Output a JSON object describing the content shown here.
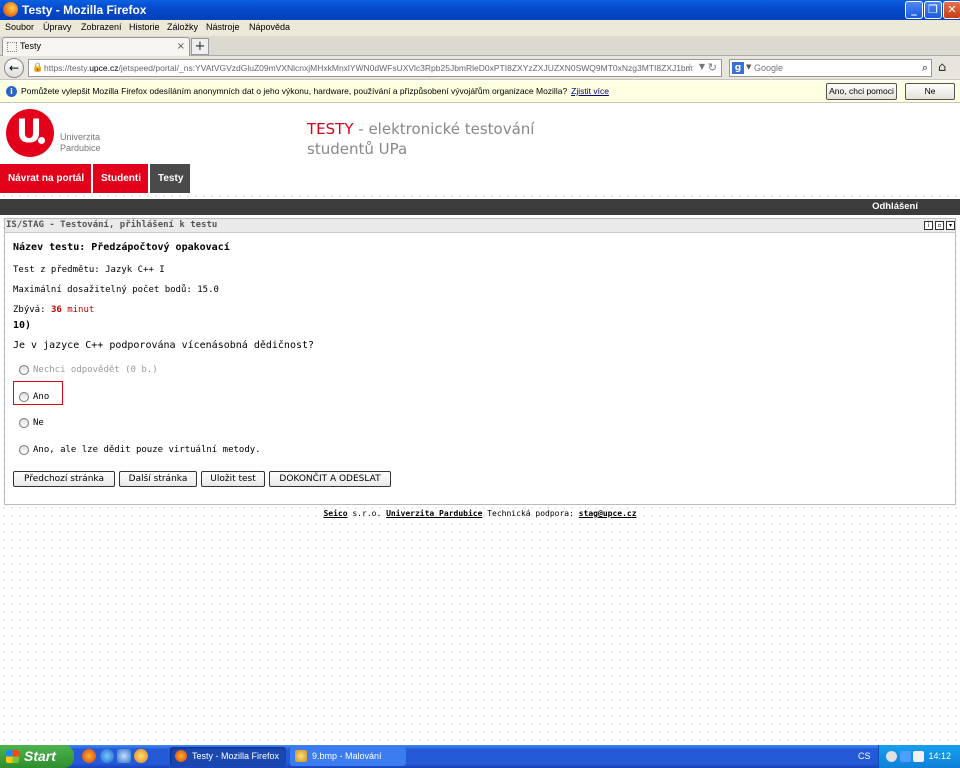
{
  "window": {
    "title": "Testy - Mozilla Firefox"
  },
  "menu": [
    "Soubor",
    "Úpravy",
    "Zobrazení",
    "Historie",
    "Záložky",
    "Nástroje",
    "Nápověda"
  ],
  "tab": {
    "label": "Testy"
  },
  "url": {
    "prefix": "https://testy.",
    "domain": "upce.cz",
    "rest": "/jetspeed/portal/_ns:YVAtVGVzdGluZ09mVXNlcnxjMHxkMnxlYWN0dWFsUXVlc3Rpb25JbmRleD0xPTI8ZXYzZXJUZXN0SWQ9MT0xNzg3MTI8ZXJ1bm5pbmdUZX"
  },
  "search": {
    "placeholder": "Google"
  },
  "notification": {
    "message": "Pomůžete vylepšit Mozilla Firefox odesíláním anonymních dat o jeho výkonu, hardware, používání a přizpůsobení vývojářům organizace Mozilla?",
    "link": "Zjistit více",
    "yes_button": "Ano, chci pomoci",
    "no_button": "Ne"
  },
  "header": {
    "logo_line1": "Univerzita",
    "logo_line2": "Pardubice",
    "title_accent": "TESTY",
    "title_rest": " - elektronické testování",
    "title_line2": "studentů UPa"
  },
  "nav": {
    "portal": "Návrat na portál",
    "students": "Studenti",
    "tests": "Testy"
  },
  "topbar": {
    "logout": "Odhlášení"
  },
  "panel": {
    "title": "IS/STAG - Testování, přihlášení k testu",
    "test_name": "Název testu: Předzápočtový opakovací",
    "subject": "Test z předmětu: Jazyk C++ I",
    "max_points": "Maximální dosažitelný počet bodů: 15.0",
    "remaining_label": "Zbývá: ",
    "remaining_value": "36",
    "remaining_unit": " minut",
    "question_number": "10)",
    "question_text": "Je v jazyce C++ podporována vícenásobná dědičnost?",
    "options": [
      "Nechci odpovědět (0 b.)",
      "Ano",
      "Ne",
      "Ano, ale lze dědit pouze virtuální metody."
    ],
    "buttons": {
      "prev": "Předchozí stránka",
      "next": "Další stránka",
      "save": "Uložit test",
      "finish": "DOKONČIT A ODESLAT"
    }
  },
  "footer": {
    "company": "Seico",
    "company_suffix": " s.r.o. ",
    "university": "Univerzita Pardubice",
    "support_label": " Technická podpora: ",
    "support_email": "stag@upce.cz"
  },
  "taskbar": {
    "start": "Start",
    "tasks": [
      "Testy - Mozilla Firefox",
      "9.bmp - Malování"
    ],
    "language": "CS",
    "clock": "14:12"
  }
}
